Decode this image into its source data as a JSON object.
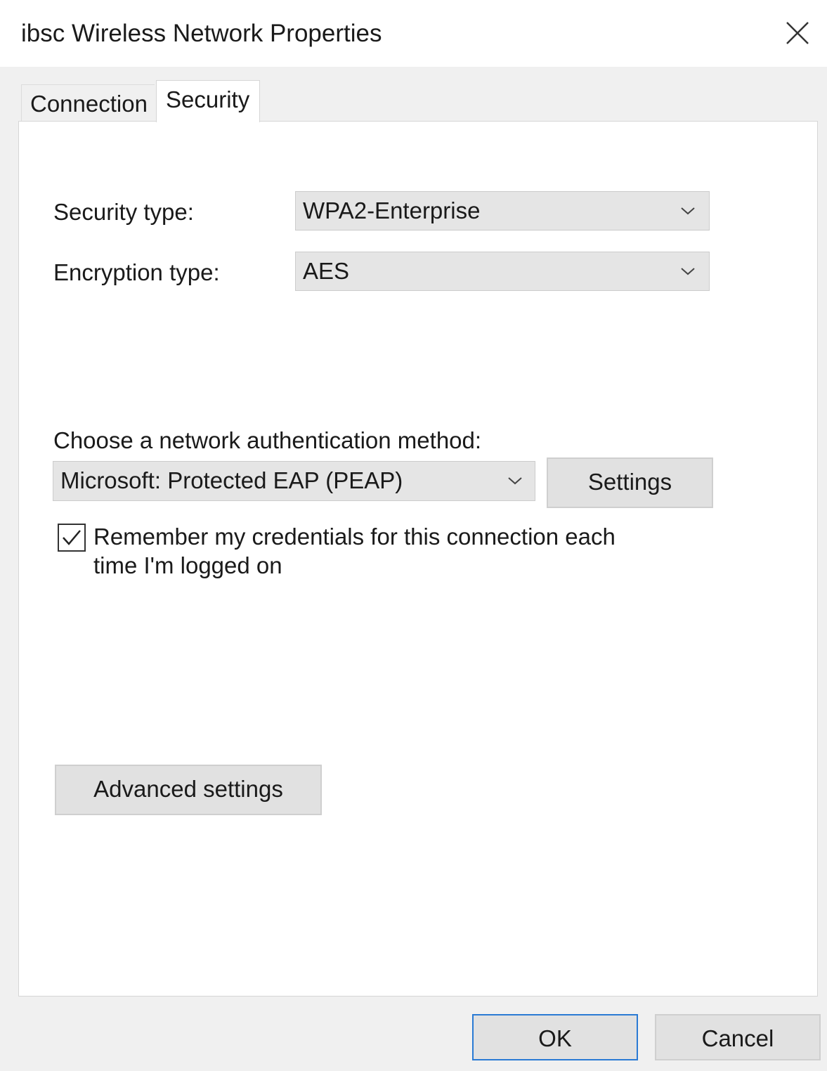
{
  "window": {
    "title": "ibsc Wireless Network Properties",
    "close_icon": "close-icon"
  },
  "tabs": [
    {
      "label": "Connection",
      "selected": false
    },
    {
      "label": "Security",
      "selected": true
    }
  ],
  "security": {
    "security_type_label": "Security type:",
    "security_type_value": "WPA2-Enterprise",
    "encryption_type_label": "Encryption type:",
    "encryption_type_value": "AES",
    "auth_method_label": "Choose a network authentication method:",
    "auth_method_value": "Microsoft: Protected EAP (PEAP)",
    "settings_button": "Settings",
    "remember_line1": "Remember my credentials for this connection each",
    "remember_line2": "time I'm logged on",
    "remember_checked": true,
    "advanced_button": "Advanced settings"
  },
  "footer": {
    "ok_button": "OK",
    "cancel_button": "Cancel"
  },
  "colors": {
    "accent_focus_border": "#2a7ad4",
    "button_face": "#e1e1e1",
    "combo_face": "#e5e5e5"
  }
}
